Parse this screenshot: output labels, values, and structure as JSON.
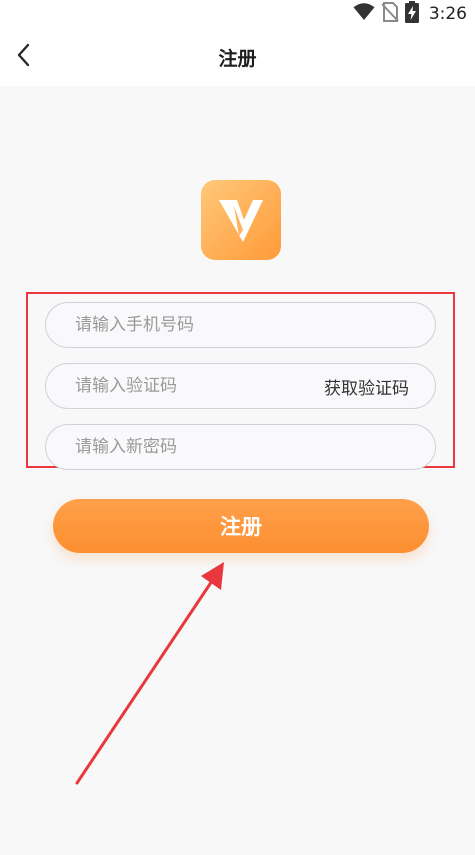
{
  "status_bar": {
    "time": "3:26",
    "icons": [
      "wifi-icon",
      "no-sim-icon",
      "battery-charging-icon"
    ]
  },
  "header": {
    "title": "注册",
    "back_icon": "chevron-left-icon"
  },
  "logo": {
    "name": "app-logo-v",
    "colors": [
      "#ffc87a",
      "#ff9a38"
    ]
  },
  "form": {
    "phone_placeholder": "请输入手机号码",
    "code_placeholder": "请输入验证码",
    "get_code_label": "获取验证码",
    "password_placeholder": "请输入新密码"
  },
  "submit_label": "注册",
  "annotations": {
    "highlight_color": "#e8383d",
    "arrow_color": "#e8383d"
  },
  "colors": {
    "accent": "#fc8f30",
    "background": "#f8f8f8"
  }
}
